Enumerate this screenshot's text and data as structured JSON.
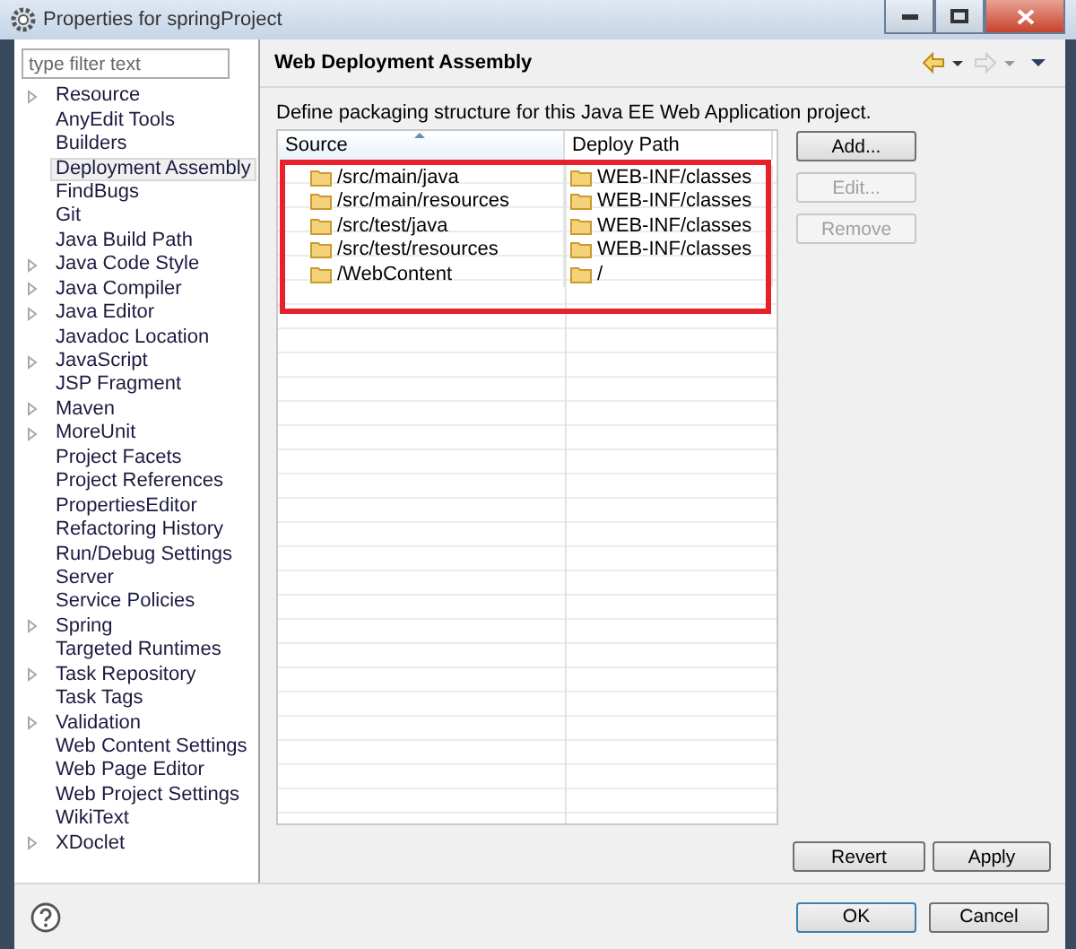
{
  "window": {
    "title": "Properties for springProject"
  },
  "sidebar": {
    "filter": {
      "placeholder": "type filter text"
    },
    "items": [
      {
        "label": "Resource",
        "expandable": true,
        "selected": false
      },
      {
        "label": "AnyEdit Tools",
        "expandable": false,
        "selected": false
      },
      {
        "label": "Builders",
        "expandable": false,
        "selected": false
      },
      {
        "label": "Deployment Assembly",
        "expandable": false,
        "selected": true
      },
      {
        "label": "FindBugs",
        "expandable": false,
        "selected": false
      },
      {
        "label": "Git",
        "expandable": false,
        "selected": false
      },
      {
        "label": "Java Build Path",
        "expandable": false,
        "selected": false
      },
      {
        "label": "Java Code Style",
        "expandable": true,
        "selected": false
      },
      {
        "label": "Java Compiler",
        "expandable": true,
        "selected": false
      },
      {
        "label": "Java Editor",
        "expandable": true,
        "selected": false
      },
      {
        "label": "Javadoc Location",
        "expandable": false,
        "selected": false
      },
      {
        "label": "JavaScript",
        "expandable": true,
        "selected": false
      },
      {
        "label": "JSP Fragment",
        "expandable": false,
        "selected": false
      },
      {
        "label": "Maven",
        "expandable": true,
        "selected": false
      },
      {
        "label": "MoreUnit",
        "expandable": true,
        "selected": false
      },
      {
        "label": "Project Facets",
        "expandable": false,
        "selected": false
      },
      {
        "label": "Project References",
        "expandable": false,
        "selected": false
      },
      {
        "label": "PropertiesEditor",
        "expandable": false,
        "selected": false
      },
      {
        "label": "Refactoring History",
        "expandable": false,
        "selected": false
      },
      {
        "label": "Run/Debug Settings",
        "expandable": false,
        "selected": false
      },
      {
        "label": "Server",
        "expandable": false,
        "selected": false
      },
      {
        "label": "Service Policies",
        "expandable": false,
        "selected": false
      },
      {
        "label": "Spring",
        "expandable": true,
        "selected": false
      },
      {
        "label": "Targeted Runtimes",
        "expandable": false,
        "selected": false
      },
      {
        "label": "Task Repository",
        "expandable": true,
        "selected": false
      },
      {
        "label": "Task Tags",
        "expandable": false,
        "selected": false
      },
      {
        "label": "Validation",
        "expandable": true,
        "selected": false
      },
      {
        "label": "Web Content Settings",
        "expandable": false,
        "selected": false
      },
      {
        "label": "Web Page Editor",
        "expandable": false,
        "selected": false
      },
      {
        "label": "Web Project Settings",
        "expandable": false,
        "selected": false
      },
      {
        "label": "WikiText",
        "expandable": false,
        "selected": false
      },
      {
        "label": "XDoclet",
        "expandable": true,
        "selected": false
      }
    ]
  },
  "page": {
    "title": "Web Deployment Assembly",
    "description": "Define packaging structure for this Java EE Web Application project.",
    "table": {
      "columns": [
        "Source",
        "Deploy Path"
      ],
      "rows": [
        [
          "/src/main/java",
          "WEB-INF/classes"
        ],
        [
          "/src/main/resources",
          "WEB-INF/classes"
        ],
        [
          "/src/test/java",
          "WEB-INF/classes"
        ],
        [
          "/src/test/resources",
          "WEB-INF/classes"
        ],
        [
          "/WebContent",
          "/"
        ]
      ]
    },
    "side_buttons": [
      {
        "label": "Add...",
        "disabled": false
      },
      {
        "label": "Edit...",
        "disabled": true
      },
      {
        "label": "Remove",
        "disabled": true
      }
    ],
    "page_buttons": [
      "Revert",
      "Apply"
    ]
  },
  "footer": {
    "buttons": [
      {
        "label": "OK",
        "default": true
      },
      {
        "label": "Cancel",
        "default": false
      }
    ]
  }
}
